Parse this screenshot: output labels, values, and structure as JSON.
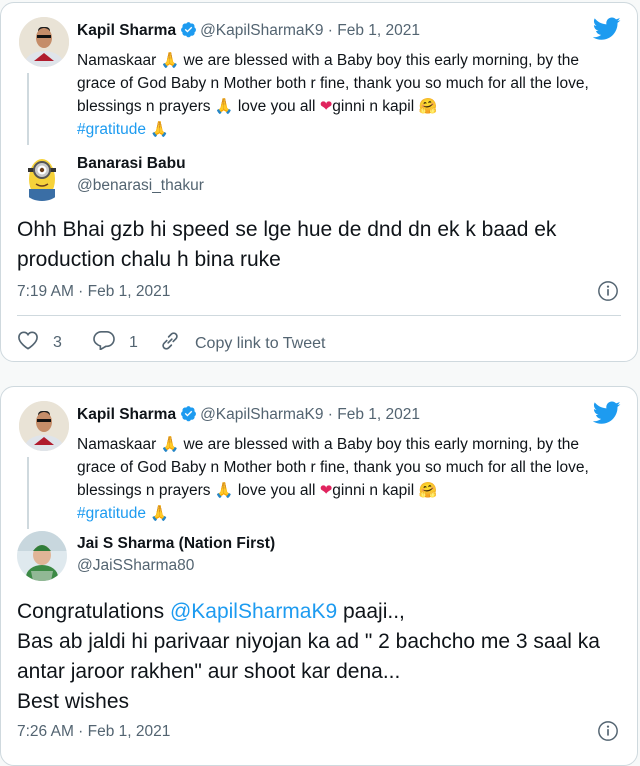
{
  "tweet1": {
    "quoted": {
      "name": "Kapil Sharma",
      "handle": "@KapilSharmaK9",
      "date": "Feb 1, 2021",
      "line1": "Namaskaar",
      "emoji_pray": "🙏",
      "line1b": " we are blessed with a Baby boy this early morning, by the grace of God Baby n Mother both r fine, thank you so much for all the love, blessings n prayers ",
      "line1c": " love you all ",
      "emoji_heart": "❤",
      "line1d": "ginni n kapil ",
      "emoji_hug": "🤗",
      "hashtag": "#gratitude"
    },
    "reply": {
      "name": "Banarasi Babu",
      "handle": "@benarasi_thakur",
      "text": "Ohh Bhai gzb hi speed se lge hue de dnd dn ek k baad ek production chalu h bina ruke",
      "timestamp": "7:19 AM · Feb 1, 2021",
      "likes": "3",
      "replies": "1",
      "copy_link": "Copy link to Tweet"
    }
  },
  "tweet2": {
    "quoted": {
      "name": "Kapil Sharma",
      "handle": "@KapilSharmaK9",
      "date": "Feb 1, 2021",
      "line1": "Namaskaar",
      "emoji_pray": "🙏",
      "line1b": " we are blessed with a Baby boy this early morning, by the grace of God Baby n Mother both r fine, thank you so much for all the love, blessings n prayers ",
      "line1c": " love you all ",
      "emoji_heart": "❤",
      "line1d": "ginni n kapil ",
      "emoji_hug": "🤗",
      "hashtag": "#gratitude"
    },
    "reply": {
      "name": "Jai S Sharma (Nation First)",
      "handle": "@JaiSSharma80",
      "text_pre": "Congratulations ",
      "mention": "@KapilSharmaK9",
      "text_post": " paaji..,",
      "line2": "Bas ab jaldi hi parivaar niyojan ka ad \" 2 bachcho me 3 saal ka antar jaroor rakhen\" aur shoot kar dena...",
      "line3": "Best wishes",
      "timestamp": "7:26 AM · Feb 1, 2021"
    }
  },
  "colors": {
    "accent": "#1d9bf0",
    "verified": "#1d9bf0",
    "muted": "#536471",
    "heart": "#e0245e"
  },
  "icons": [
    "twitter-bird-icon",
    "verified-badge-icon",
    "info-icon",
    "heart-icon",
    "reply-icon",
    "link-icon"
  ]
}
